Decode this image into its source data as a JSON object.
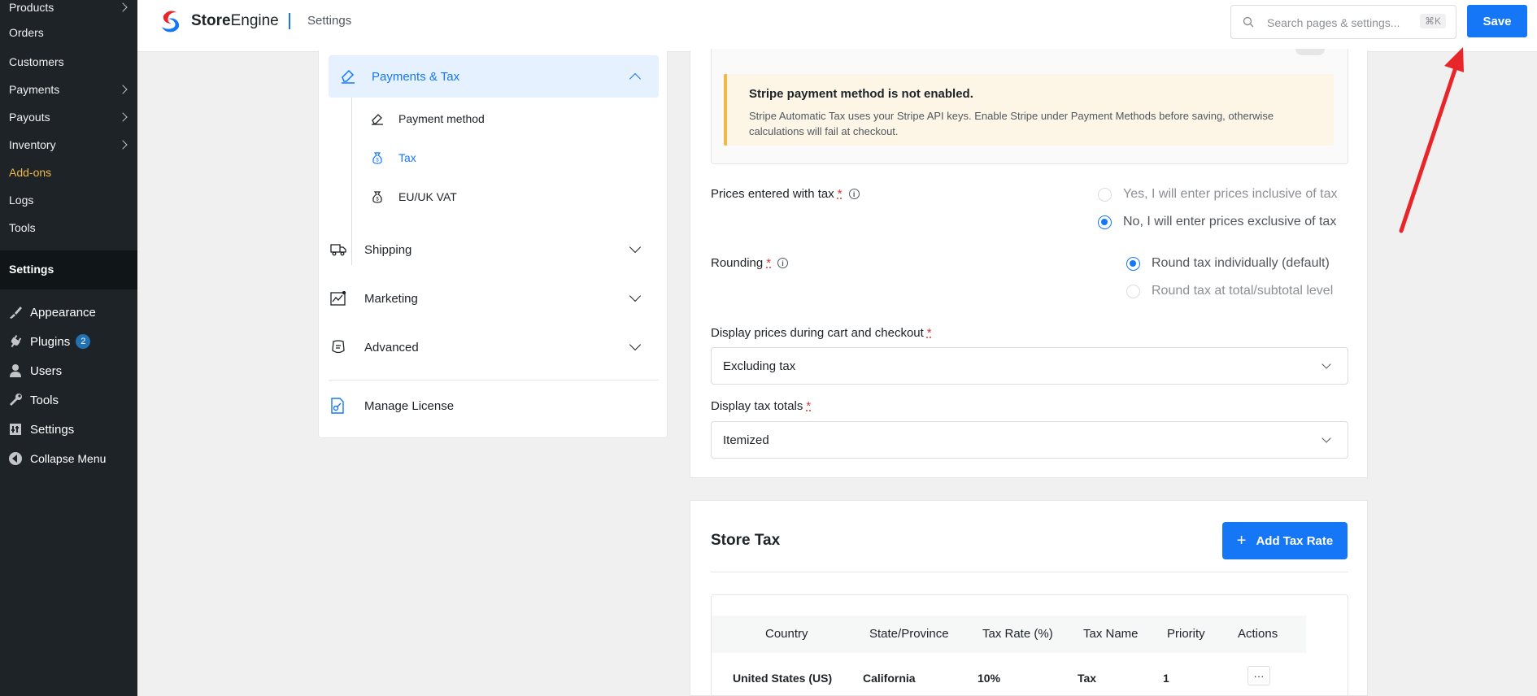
{
  "wp_menu": {
    "items": [
      {
        "label": "Products",
        "has_sub": true
      },
      {
        "label": "Orders",
        "has_sub": false
      },
      {
        "label": "Customers",
        "has_sub": false
      },
      {
        "label": "Payments",
        "has_sub": true
      },
      {
        "label": "Payouts",
        "has_sub": true
      },
      {
        "label": "Inventory",
        "has_sub": true
      },
      {
        "label": "Add-ons",
        "has_sub": false
      },
      {
        "label": "Logs",
        "has_sub": false
      },
      {
        "label": "Tools",
        "has_sub": false
      }
    ],
    "current": "Settings",
    "top_items": [
      {
        "label": "Appearance",
        "icon": "brush-icon"
      },
      {
        "label": "Plugins",
        "icon": "plug-icon",
        "badge": "2"
      },
      {
        "label": "Users",
        "icon": "user-icon"
      },
      {
        "label": "Tools",
        "icon": "wrench-icon"
      },
      {
        "label": "Settings",
        "icon": "settings-icon"
      },
      {
        "label": "Collapse Menu",
        "icon": "collapse-icon"
      }
    ]
  },
  "header": {
    "brand_bold": "Store",
    "brand_rest": "Engine",
    "page_title": "Settings",
    "search_placeholder": "Search pages & settings...",
    "search_shortcut": "⌘K",
    "save_label": "Save"
  },
  "settings_nav": {
    "active_group": "Payments & Tax",
    "sub_items": [
      {
        "label": "Payment method",
        "icon": "eraser-icon",
        "active": false
      },
      {
        "label": "Tax",
        "icon": "money-bag-icon",
        "active": true
      },
      {
        "label": "EU/UK VAT",
        "icon": "money-bag-icon",
        "active": false
      }
    ],
    "groups": [
      {
        "label": "Shipping",
        "icon": "truck-icon"
      },
      {
        "label": "Marketing",
        "icon": "chart-icon"
      },
      {
        "label": "Advanced",
        "icon": "advanced-icon"
      }
    ],
    "license": "Manage License"
  },
  "tax_settings": {
    "notice_title": "Stripe payment method is not enabled.",
    "notice_body": "Stripe Automatic Tax uses your Stripe API keys. Enable Stripe under Payment Methods before saving, otherwise calculations will fail at checkout.",
    "prices_label": "Prices entered with tax",
    "prices_options": [
      {
        "label": "Yes, I will enter prices inclusive of tax",
        "selected": false
      },
      {
        "label": "No, I will enter prices exclusive of tax",
        "selected": true
      }
    ],
    "rounding_label": "Rounding",
    "rounding_options": [
      {
        "label": "Round tax individually (default)",
        "selected": true
      },
      {
        "label": "Round tax at total/subtotal level",
        "selected": false
      }
    ],
    "display_prices_label": "Display prices during cart and checkout",
    "display_prices_value": "Excluding tax",
    "display_totals_label": "Display tax totals",
    "display_totals_value": "Itemized",
    "required_mark": "*",
    "info_mark": "i"
  },
  "store_tax": {
    "title": "Store Tax",
    "add_label": "Add Tax Rate",
    "add_icon": "+",
    "columns": [
      "Country",
      "State/Province",
      "Tax Rate (%)",
      "Tax Name",
      "Priority",
      "Actions"
    ],
    "rows": [
      {
        "country": "United States (US)",
        "state": "California",
        "rate": "10%",
        "name": "Tax",
        "priority": "1",
        "actions": "···"
      }
    ]
  },
  "colors": {
    "accent": "#1577f6",
    "wp_sidebar": "#1d2327",
    "notice_border": "#f0b849",
    "arrow": "#e8262a"
  }
}
